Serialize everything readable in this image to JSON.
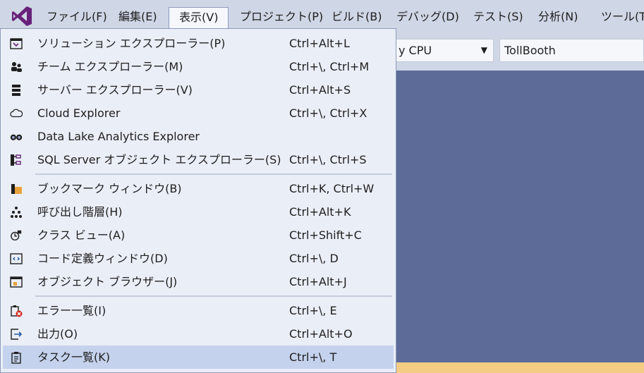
{
  "menubar": {
    "items": [
      {
        "label": "ファイル(F)"
      },
      {
        "label": "編集(E)"
      },
      {
        "label": "表示(V)"
      },
      {
        "label": "プロジェクト(P)"
      },
      {
        "label": "ビルド(B)"
      },
      {
        "label": "デバッグ(D)"
      },
      {
        "label": "テスト(S)"
      },
      {
        "label": "分析(N)"
      },
      {
        "label": "ツール(T)"
      }
    ],
    "active_index": 2
  },
  "toolbar": {
    "platform_value": "y CPU",
    "project_value": "TollBooth"
  },
  "view_menu": {
    "items": [
      {
        "label": "ソリューション エクスプローラー(P)",
        "shortcut": "Ctrl+Alt+L",
        "icon": "solution-explorer-icon"
      },
      {
        "label": "チーム エクスプローラー(M)",
        "shortcut": "Ctrl+\\, Ctrl+M",
        "icon": "team-explorer-icon"
      },
      {
        "label": "サーバー エクスプローラー(V)",
        "shortcut": "Ctrl+Alt+S",
        "icon": "server-explorer-icon"
      },
      {
        "label": "Cloud Explorer",
        "shortcut": "Ctrl+\\, Ctrl+X",
        "icon": "cloud-icon"
      },
      {
        "label": "Data Lake Analytics Explorer",
        "shortcut": "",
        "icon": "binoculars-icon"
      },
      {
        "label": "SQL Server オブジェクト エクスプローラー(S)",
        "shortcut": "Ctrl+\\, Ctrl+S",
        "icon": "sql-object-explorer-icon"
      },
      {
        "label": "ブックマーク ウィンドウ(B)",
        "shortcut": "Ctrl+K, Ctrl+W",
        "icon": "bookmark-icon"
      },
      {
        "label": "呼び出し階層(H)",
        "shortcut": "Ctrl+Alt+K",
        "icon": "call-hierarchy-icon"
      },
      {
        "label": "クラス ビュー(A)",
        "shortcut": "Ctrl+Shift+C",
        "icon": "class-view-icon"
      },
      {
        "label": "コード定義ウィンドウ(D)",
        "shortcut": "Ctrl+\\, D",
        "icon": "code-definition-icon"
      },
      {
        "label": "オブジェクト ブラウザー(J)",
        "shortcut": "Ctrl+Alt+J",
        "icon": "object-browser-icon"
      },
      {
        "label": "エラー一覧(I)",
        "shortcut": "Ctrl+\\, E",
        "icon": "error-list-icon"
      },
      {
        "label": "出力(O)",
        "shortcut": "Ctrl+Alt+O",
        "icon": "output-icon"
      },
      {
        "label": "タスク一覧(K)",
        "shortcut": "Ctrl+\\, T",
        "icon": "task-list-icon"
      }
    ],
    "highlighted_index": 13
  },
  "colors": {
    "accent": "#68217a",
    "editor_bg": "#5d6b99",
    "highlight": "#c5d2ed",
    "status_bar": "#f5cc84"
  }
}
